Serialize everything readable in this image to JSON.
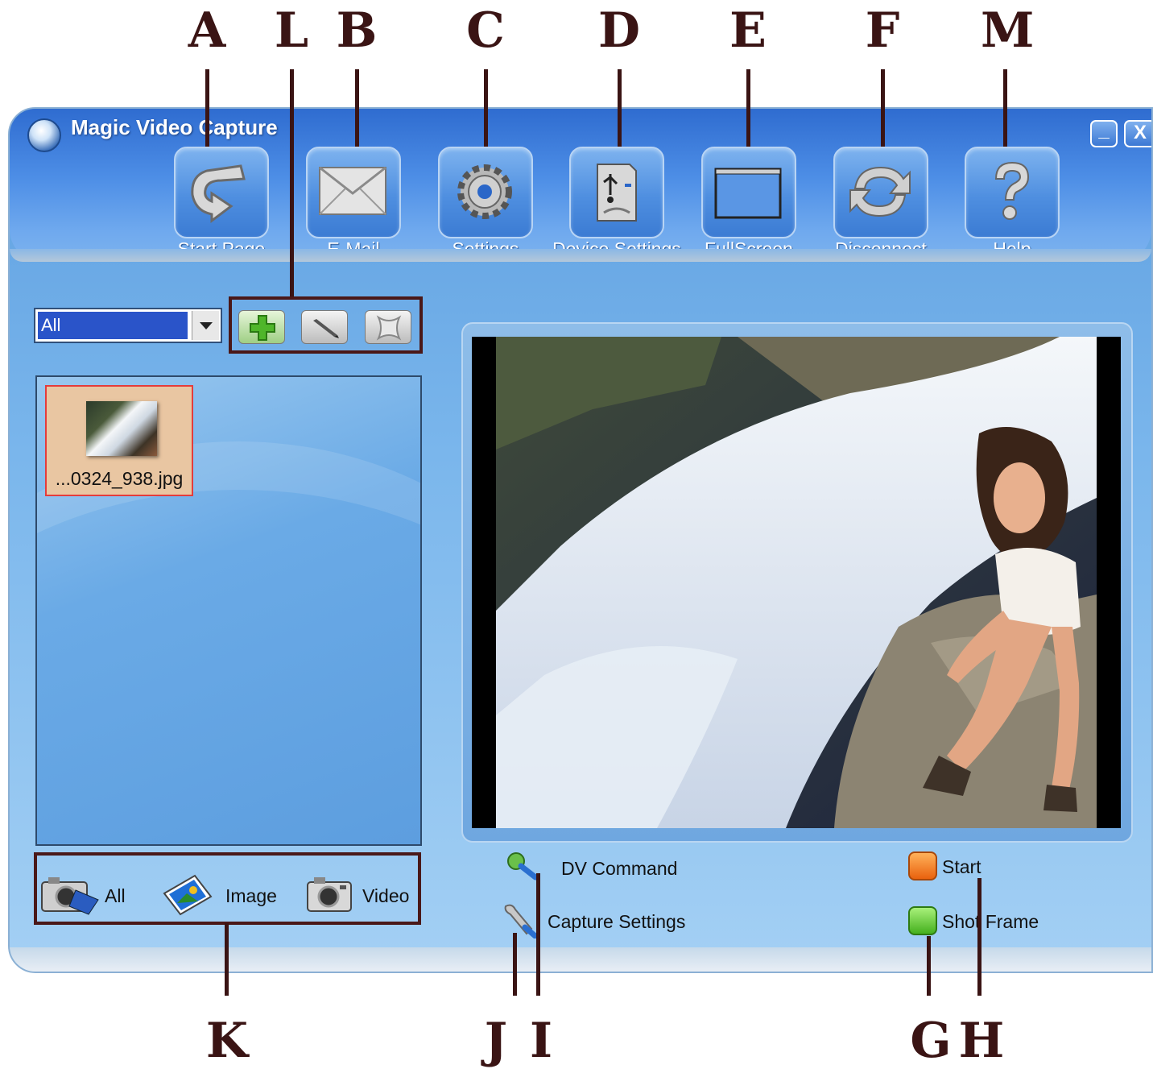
{
  "window": {
    "title": "Magic Video Capture",
    "minimize_label": "_",
    "close_label": "X"
  },
  "toolbar": [
    {
      "label": "Start Page",
      "icon": "start-page-arrow-icon"
    },
    {
      "label": "E-Mail",
      "icon": "envelope-icon"
    },
    {
      "label": "Settings",
      "icon": "gear-icon"
    },
    {
      "label": "Device Settings",
      "icon": "usb-device-icon"
    },
    {
      "label": "FullScreen",
      "icon": "fullscreen-icon"
    },
    {
      "label": "Disconnect",
      "icon": "refresh-icon"
    },
    {
      "label": "Help",
      "icon": "question-icon"
    }
  ],
  "sidebar": {
    "filter_value": "All",
    "action_icons": [
      "add-icon",
      "edit-icon",
      "delete-icon"
    ],
    "files": [
      {
        "name": "...0324_938.jpg"
      }
    ],
    "categories": [
      {
        "label": "All",
        "icon": "camera-all-icon"
      },
      {
        "label": "Image",
        "icon": "image-icon"
      },
      {
        "label": "Video",
        "icon": "camera-video-icon"
      }
    ]
  },
  "controls": {
    "dv_command": "DV Command",
    "capture_settings": "Capture Settings",
    "start": "Start",
    "shot_frame": "Shot Frame"
  },
  "callouts": {
    "top": [
      "A",
      "L",
      "B",
      "C",
      "D",
      "E",
      "F",
      "M"
    ],
    "bottom": [
      "K",
      "J",
      "I",
      "G",
      "H"
    ]
  },
  "colors": {
    "accent": "#3b7bd3",
    "callout": "#3a1414",
    "start_button": "#f07a1a",
    "shot_button": "#58c234"
  }
}
